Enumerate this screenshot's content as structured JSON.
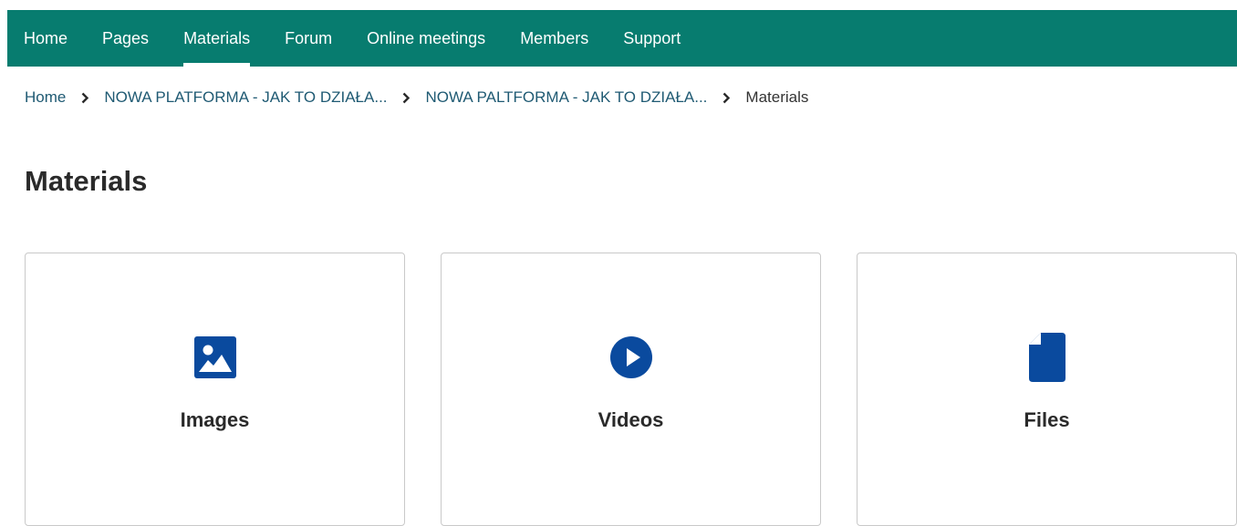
{
  "nav": {
    "items": [
      {
        "label": "Home",
        "active": false
      },
      {
        "label": "Pages",
        "active": false
      },
      {
        "label": "Materials",
        "active": true
      },
      {
        "label": "Forum",
        "active": false
      },
      {
        "label": "Online meetings",
        "active": false
      },
      {
        "label": "Members",
        "active": false
      },
      {
        "label": "Support",
        "active": false
      }
    ]
  },
  "breadcrumb": {
    "items": [
      {
        "label": "Home"
      },
      {
        "label": "NOWA PLATFORMA - JAK TO DZIAŁA..."
      },
      {
        "label": "NOWA PALTFORMA - JAK TO DZIAŁA..."
      },
      {
        "label": "Materials"
      }
    ]
  },
  "page": {
    "title": "Materials"
  },
  "cards": [
    {
      "label": "Images",
      "icon": "image-icon"
    },
    {
      "label": "Videos",
      "icon": "play-circle-icon"
    },
    {
      "label": "Files",
      "icon": "file-icon"
    }
  ],
  "colors": {
    "nav_bg": "#077c6f",
    "icon_blue": "#0a4a9e",
    "link": "#1f5a73"
  }
}
